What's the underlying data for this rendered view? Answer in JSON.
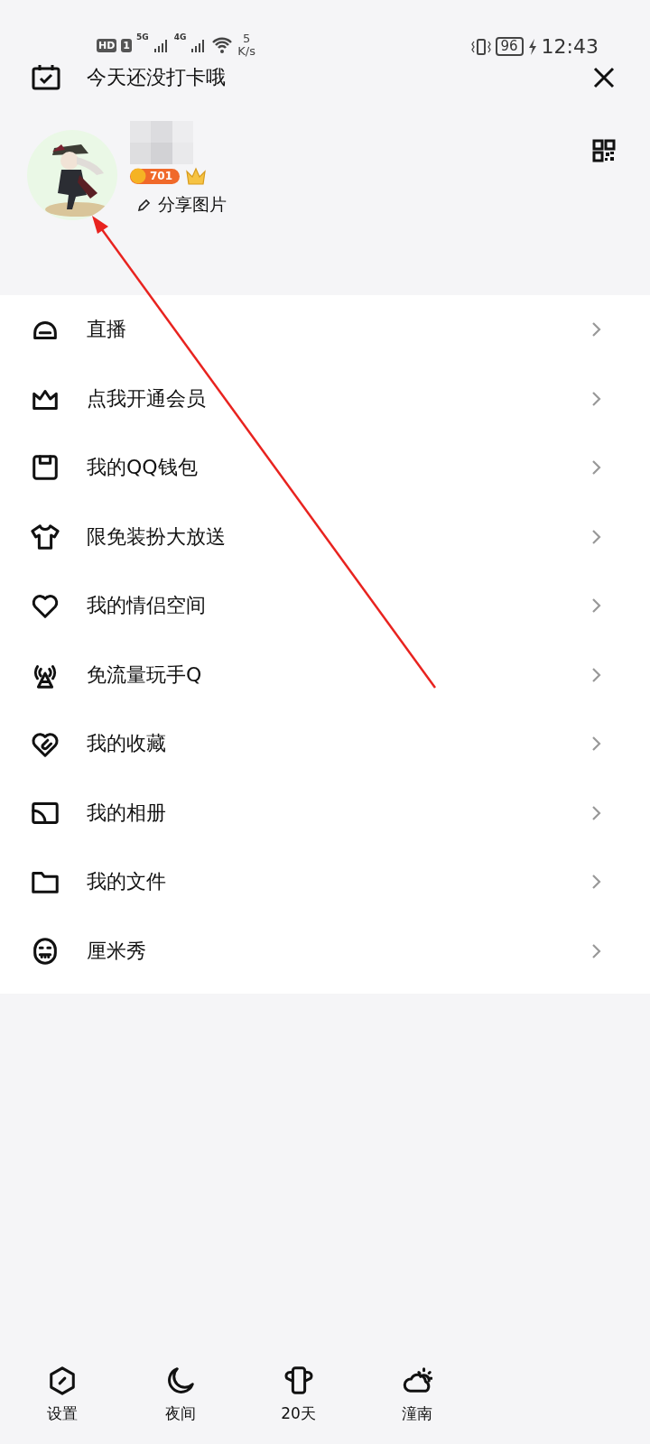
{
  "status_bar": {
    "hd": "HD",
    "sim": "1",
    "network_1": "5G",
    "network_2": "4G",
    "speed_value": "5",
    "speed_unit": "K/s",
    "battery": "96",
    "time": "12:43"
  },
  "header": {
    "checkin_text": "今天还没打卡哦"
  },
  "profile": {
    "level": "701",
    "action": "分享图片"
  },
  "menu": [
    {
      "label": "直播"
    },
    {
      "label": "点我开通会员"
    },
    {
      "label": "我的QQ钱包"
    },
    {
      "label": "限免装扮大放送"
    },
    {
      "label": "我的情侣空间"
    },
    {
      "label": "免流量玩手Q"
    },
    {
      "label": "我的收藏"
    },
    {
      "label": "我的相册"
    },
    {
      "label": "我的文件"
    },
    {
      "label": "厘米秀"
    }
  ],
  "bottom_bar": [
    {
      "label": "设置"
    },
    {
      "label": "夜间"
    },
    {
      "label": "20天"
    },
    {
      "label": "潼南"
    }
  ]
}
